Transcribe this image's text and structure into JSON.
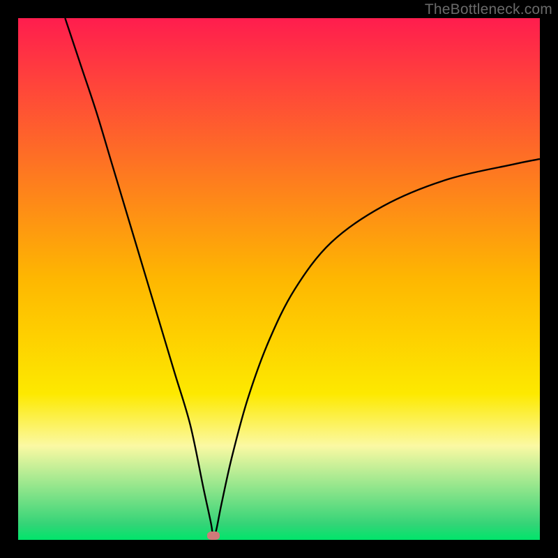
{
  "attribution": "TheBottleneck.com",
  "chart_data": {
    "type": "line",
    "title": "",
    "xlabel": "",
    "ylabel": "",
    "xlim": [
      0,
      100
    ],
    "ylim": [
      0,
      100
    ],
    "background": {
      "type": "gradient",
      "stops": [
        {
          "p": 0.0,
          "c": "#ff1d4e"
        },
        {
          "p": 0.5,
          "c": "#feb701"
        },
        {
          "p": 0.72,
          "c": "#fde900"
        },
        {
          "p": 0.82,
          "c": "#fbf9a3"
        },
        {
          "p": 0.97,
          "c": "#34d477"
        },
        {
          "p": 1.0,
          "c": "#00e56b"
        }
      ]
    },
    "curve": {
      "note": "V-shaped bottleneck curve; y=0 is optimum",
      "x": [
        9,
        12,
        15,
        18,
        21,
        24,
        27,
        30,
        33,
        35.5,
        37,
        37.4,
        38,
        39,
        41,
        44,
        48,
        53,
        60,
        70,
        82,
        95,
        100
      ],
      "y": [
        100,
        91,
        82,
        72,
        62,
        52,
        42,
        32,
        22,
        10,
        3,
        0.4,
        2,
        7,
        16,
        27,
        38,
        48,
        57,
        64,
        69,
        72,
        73
      ]
    },
    "marker": {
      "x": 37.4,
      "y": 0.8,
      "color": "#cf7a79"
    }
  },
  "colors": {
    "frame": "#000000",
    "curve": "#000000",
    "attribution": "#6a6a6a"
  }
}
